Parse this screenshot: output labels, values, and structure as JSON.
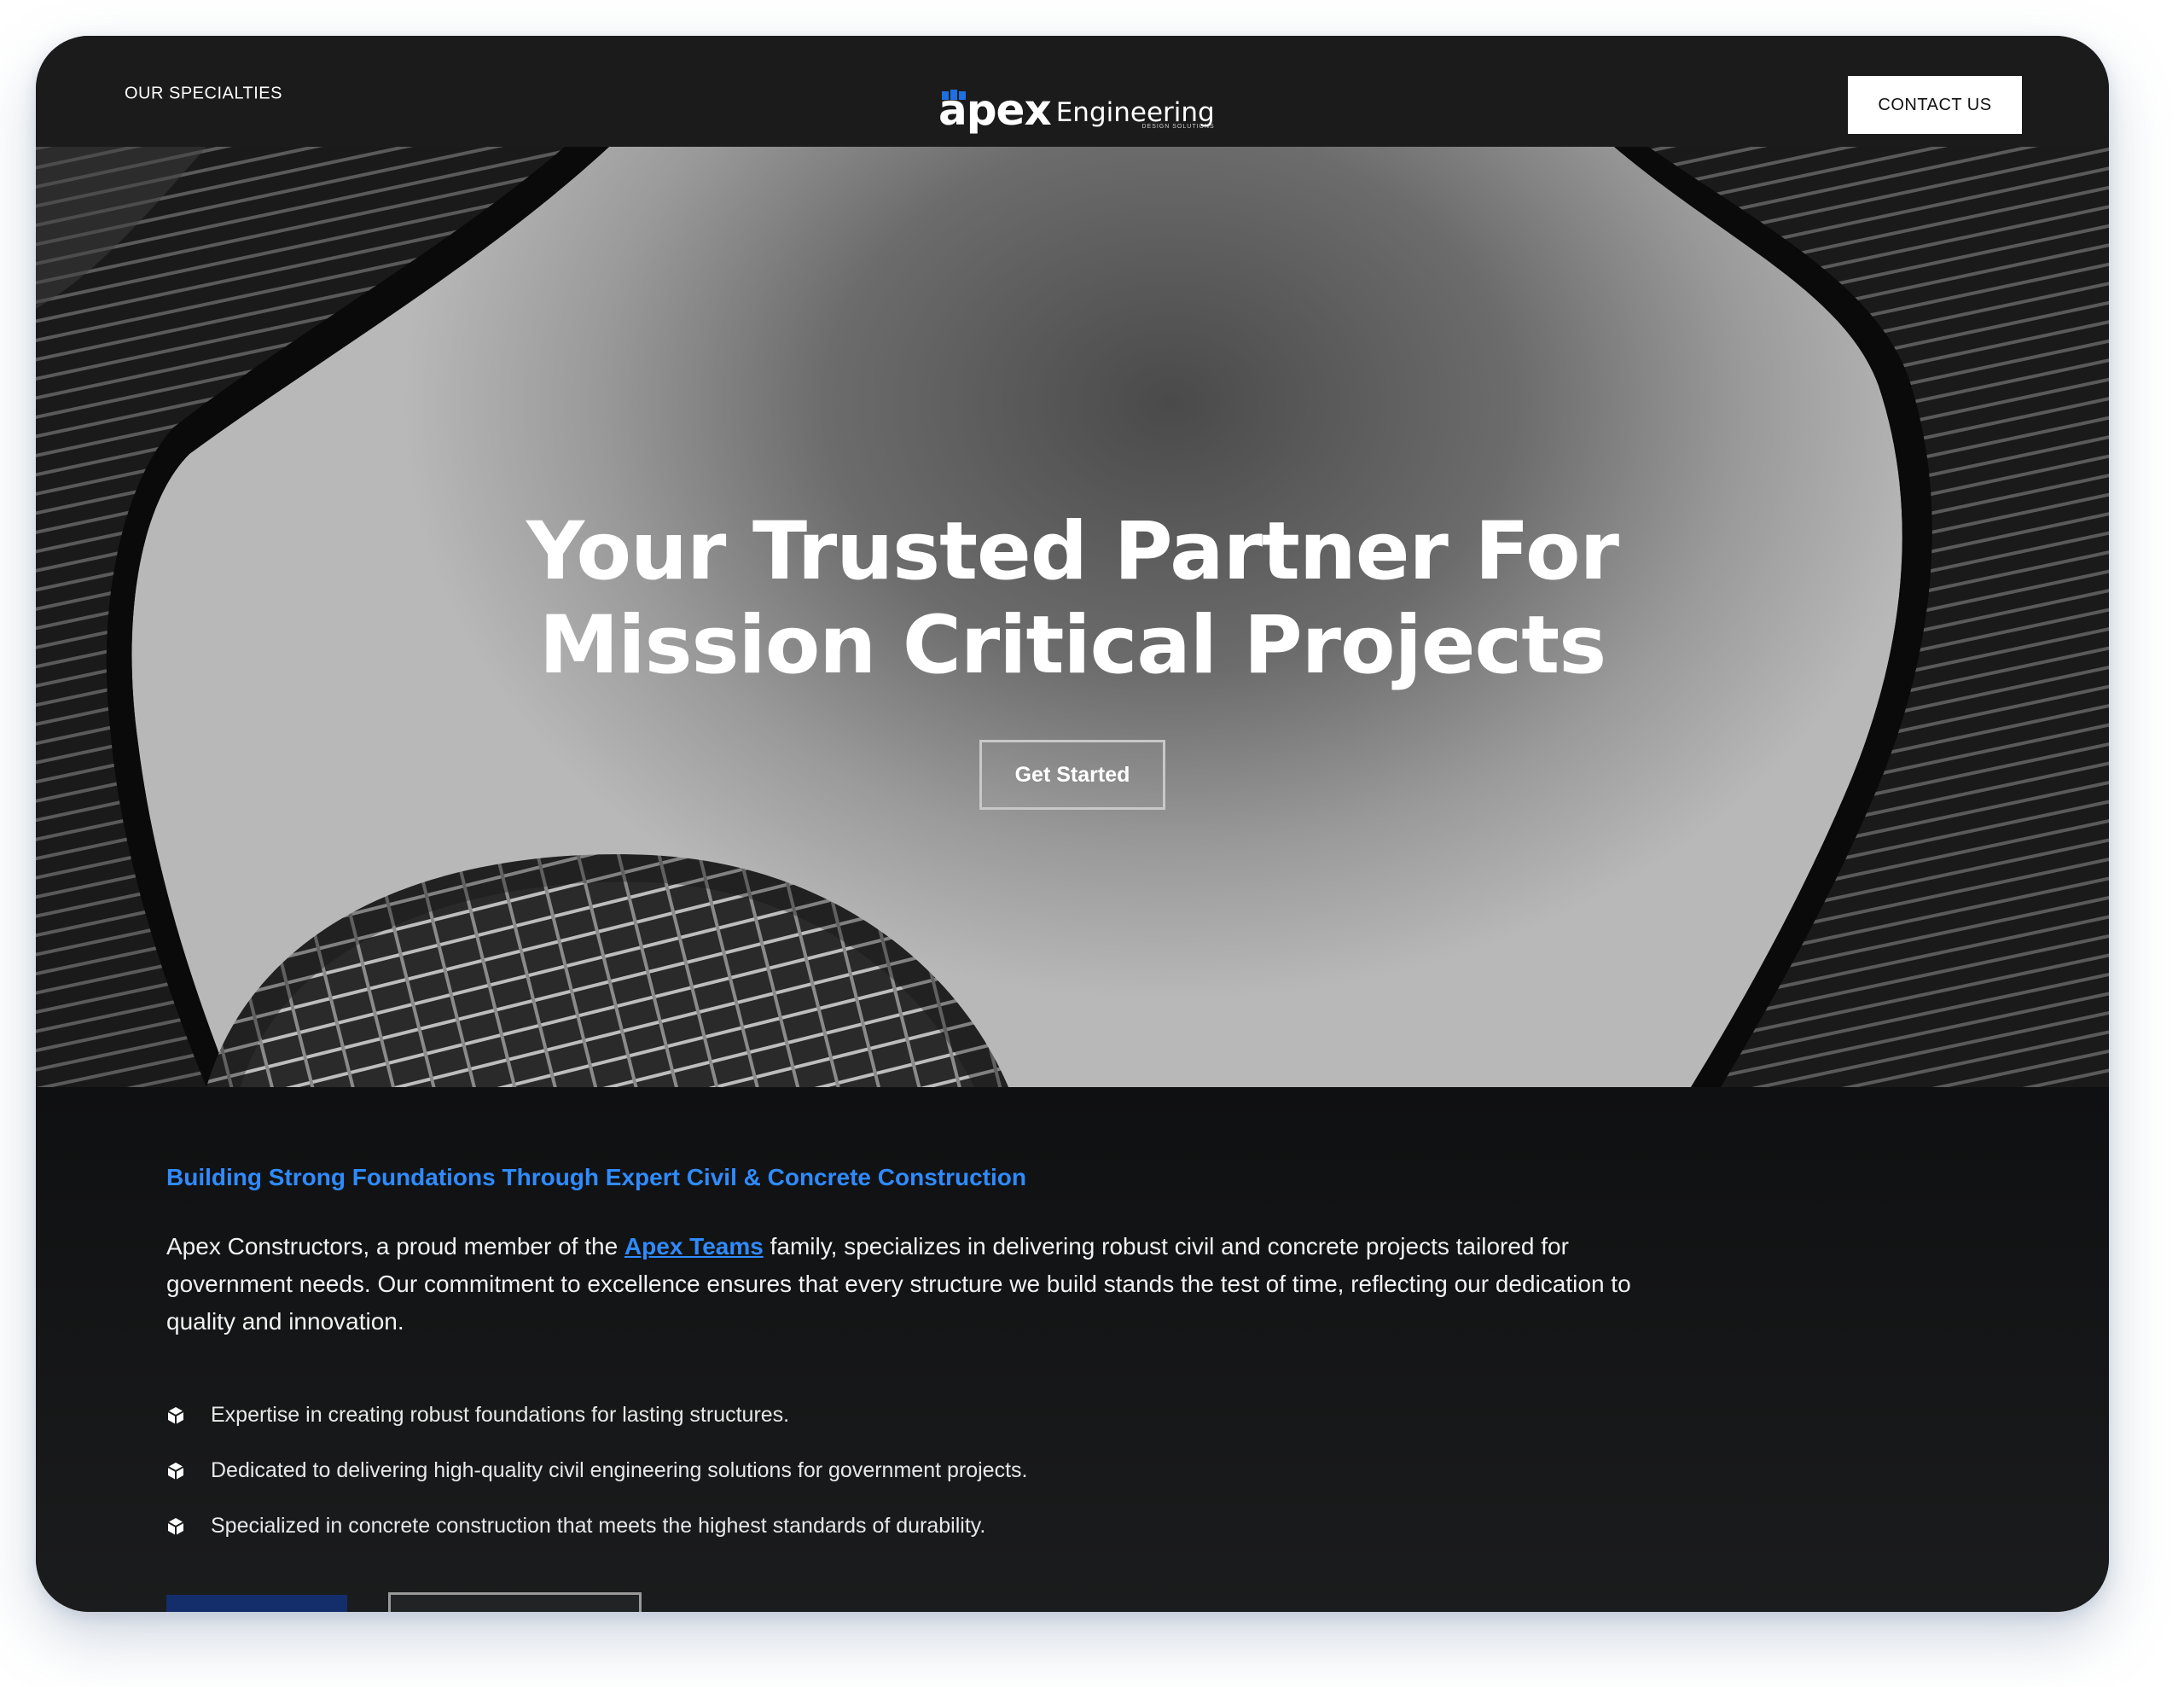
{
  "header": {
    "nav_specialties": "OUR SPECIALTIES",
    "logo_mark": "apex",
    "logo_word": "Engineering",
    "logo_tagline": "DESIGN SOLUTIONS",
    "contact_label": "CONTACT US"
  },
  "hero": {
    "title_line1": "Your Trusted Partner For",
    "title_line2": "Mission Critical Projects",
    "cta_label": "Get Started"
  },
  "about": {
    "kicker": "Building Strong Foundations Through Expert Civil & Concrete Construction",
    "para_before": "Apex Constructors, a proud member of the ",
    "para_link": "Apex Teams",
    "para_after": " family, specializes in delivering robust civil and concrete projects tailored for government needs. Our commitment to excellence ensures that every structure we build stands the test of time, reflecting our dedication to quality and innovation.",
    "features": [
      "Expertise in creating robust foundations for lasting structures.",
      "Dedicated to delivering high-quality civil engineering solutions for government projects.",
      "Specialized in concrete construction that meets the highest standards of durability."
    ]
  },
  "colors": {
    "accent": "#2f8bff",
    "logo_accent": "#1e6fe0",
    "primary_button": "#142d6b",
    "background": "#1b1b1c"
  },
  "icons": {
    "feature_bullet": "cube-icon"
  }
}
